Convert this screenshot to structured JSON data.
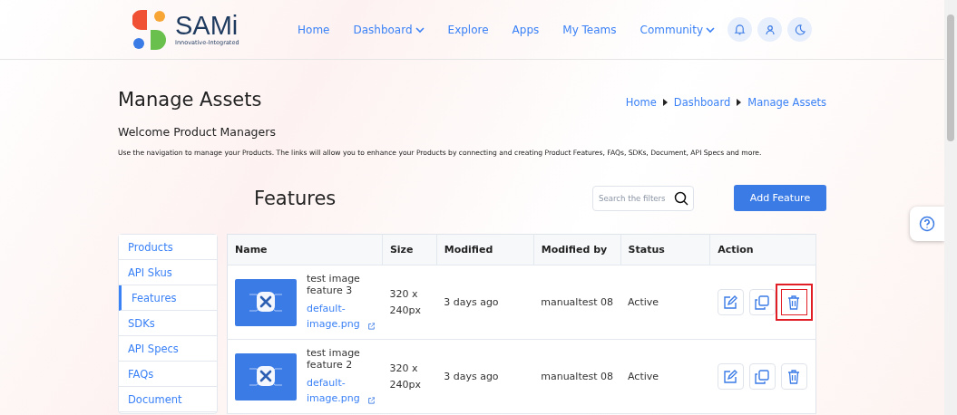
{
  "header": {
    "logo_text": "SAMi",
    "logo_tagline": "Innovative-Integrated",
    "nav": [
      {
        "label": "Home",
        "dropdown": false
      },
      {
        "label": "Dashboard",
        "dropdown": true
      },
      {
        "label": "Explore",
        "dropdown": false
      },
      {
        "label": "Apps",
        "dropdown": false
      },
      {
        "label": "My Teams",
        "dropdown": false
      },
      {
        "label": "Community",
        "dropdown": true
      }
    ]
  },
  "page": {
    "title": "Manage Assets",
    "breadcrumb": [
      "Home",
      "Dashboard",
      "Manage Assets"
    ],
    "welcome": "Welcome Product Managers",
    "description": "Use the navigation to manage your Products. The links will allow you to enhance your Products by connecting and creating Product Features, FAQs, SDKs, Document, API Specs and more."
  },
  "section": {
    "title": "Features",
    "search": {
      "placeholder": "Search the filters"
    },
    "add_button": "Add Feature"
  },
  "sidebar": {
    "items": [
      {
        "label": "Products",
        "selected": false
      },
      {
        "label": "API Skus",
        "selected": false
      },
      {
        "label": "Features",
        "selected": true
      },
      {
        "label": "SDKs",
        "selected": false
      },
      {
        "label": "API Specs",
        "selected": false
      },
      {
        "label": "FAQs",
        "selected": false
      },
      {
        "label": "Document",
        "selected": false
      }
    ]
  },
  "table": {
    "columns": [
      "Name",
      "Size",
      "Modified",
      "Modified by",
      "Status",
      "Action"
    ],
    "rows": [
      {
        "name": "test image feature 3",
        "file": "default-image.png",
        "size": "320 x 240px",
        "modified": "3 days ago",
        "modified_by": "manualtest 08",
        "status": "Active",
        "delete_highlighted": true
      },
      {
        "name": "test image feature 2",
        "file": "default-image.png",
        "size": "320 x 240px",
        "modified": "3 days ago",
        "modified_by": "manualtest 08",
        "status": "Active",
        "delete_highlighted": false
      }
    ]
  }
}
